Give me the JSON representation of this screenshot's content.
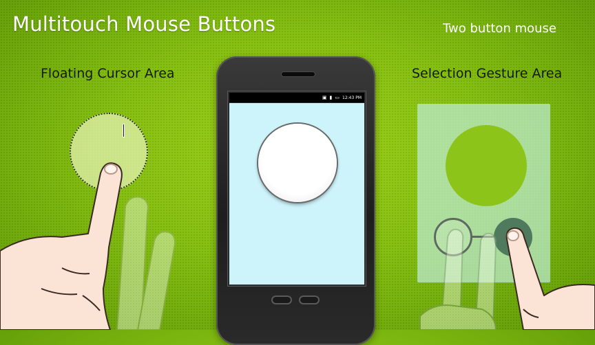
{
  "header": {
    "title": "Multitouch Mouse Buttons",
    "subtitle": "Two button mouse"
  },
  "labels": {
    "left_area": "Floating Cursor Area",
    "right_area": "Selection Gesture Area"
  },
  "phone": {
    "status_time": "12:43 PM"
  },
  "icons": {
    "cursor": "ibeam-cursor-icon",
    "hand": "hand-icon"
  },
  "colors": {
    "background": "#8cc414",
    "screen": "#cdf3fb",
    "selection_panel": "#bfecd2",
    "selection_circle": "#8dc41a"
  }
}
